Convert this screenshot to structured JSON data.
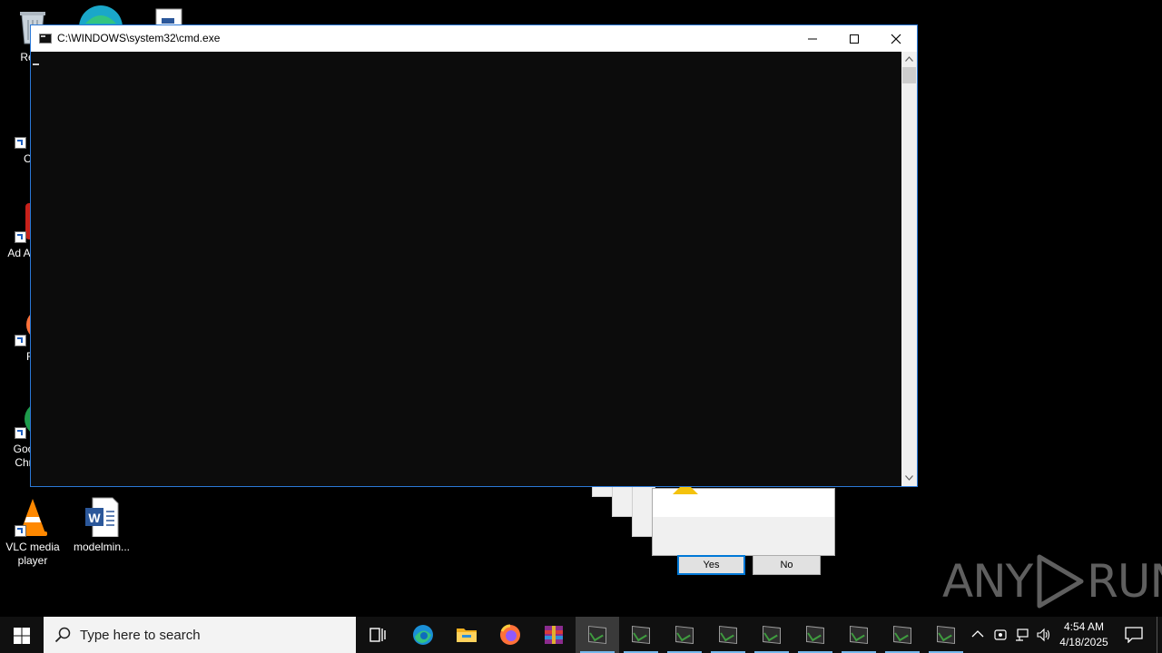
{
  "desktop": {
    "icons": [
      {
        "label": "Recy",
        "icon": "recycle-bin-icon"
      },
      {
        "label": "CCl",
        "icon": "ccleaner-icon"
      },
      {
        "label": "Ad Acr",
        "icon": "adobe-acrobat-icon"
      },
      {
        "label": "Fir",
        "icon": "firefox-icon"
      },
      {
        "label": "Goo Chr",
        "icon": "chrome-icon"
      },
      {
        "label": "VLC media player",
        "icon": "vlc-icon"
      },
      {
        "label": "modelmin...",
        "icon": "word-document-icon"
      }
    ]
  },
  "cmd_window": {
    "title": "C:\\WINDOWS\\system32\\cmd.exe",
    "icon": "cmd-icon"
  },
  "dialog": {
    "yes_label": "Yes",
    "no_label": "No",
    "icon": "warning-icon"
  },
  "watermark": {
    "text_left": "ANY",
    "text_right": "RUN"
  },
  "taskbar": {
    "search_placeholder": "Type here to search",
    "pinned": [
      "task-view-icon",
      "edge-icon",
      "file-explorer-icon",
      "firefox-icon",
      "winrar-icon"
    ],
    "running_cmd_count": 9,
    "time": "4:54 AM",
    "date": "4/18/2025"
  },
  "colors": {
    "console_bg": "#0c0c0c",
    "taskbar_bg": "#101010",
    "accent": "#76b9ed",
    "window_border": "#2b79d8"
  }
}
